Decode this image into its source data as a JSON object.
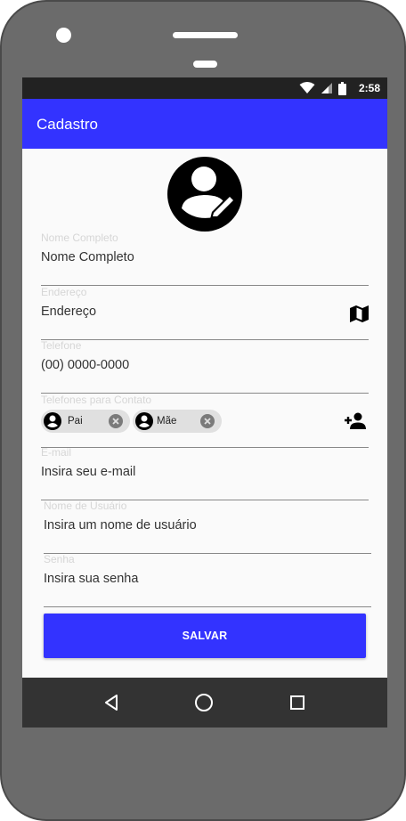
{
  "status_bar": {
    "time": "2:58",
    "icons": [
      "wifi-icon",
      "signal-icon",
      "battery-icon"
    ]
  },
  "app_bar": {
    "title": "Cadastro",
    "color": "#3333ff"
  },
  "profile": {
    "avatar_icon": "account-circle-icon",
    "edit_icon": "pencil-icon"
  },
  "form": {
    "full_name": {
      "label": "Nome Completo",
      "placeholder": "Nome Completo"
    },
    "address": {
      "label": "Endereço",
      "placeholder": "Endereço",
      "action_icon": "map-icon"
    },
    "phone": {
      "label": "Telefone",
      "placeholder": "(00) 0000-0000"
    },
    "contacts": {
      "label": "Telefones para Contato",
      "chips": [
        {
          "label": "Pai"
        },
        {
          "label": "Mãe"
        }
      ],
      "action_icon": "add-person-icon"
    },
    "email": {
      "label": "E-mail",
      "placeholder": "Insira seu e-mail"
    },
    "username": {
      "label": "Nome de Usuário",
      "placeholder": "Insira um nome de usuário"
    },
    "password": {
      "label": "Senha",
      "placeholder": "Insira sua senha"
    },
    "save_button": {
      "label": "SALVAR"
    }
  },
  "nav_bar": {
    "icons": [
      "back-triangle-icon",
      "home-circle-icon",
      "recents-square-icon"
    ]
  }
}
